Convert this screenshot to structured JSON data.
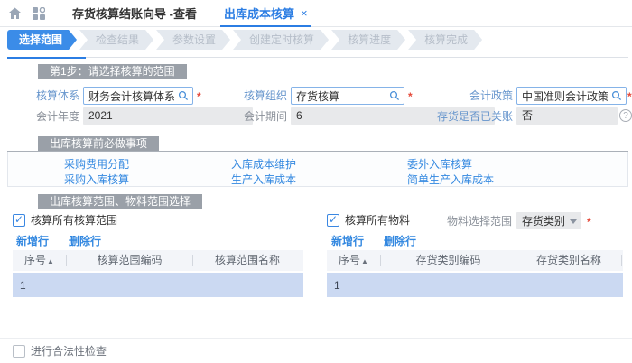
{
  "ui": {
    "required_mark": "*"
  },
  "icons": {
    "close_tab": "×",
    "sort_asc": "▲",
    "help": "?"
  },
  "topbar": {
    "tabs": [
      {
        "label": "存货核算结账向导 -查看",
        "active": false
      },
      {
        "label": "出库成本核算",
        "active": true
      }
    ]
  },
  "wizard": {
    "steps": [
      "选择范围",
      "检查结果",
      "参数设置",
      "创建定时核算",
      "核算进度",
      "核算完成"
    ],
    "active_step": "选择范围"
  },
  "step1": {
    "title": "第1步：请选择核算的范围",
    "fields": {
      "accounting_system": {
        "label": "核算体系",
        "value": "财务会计核算体系",
        "required": true
      },
      "accounting_org": {
        "label": "核算组织",
        "value": "存货核算",
        "required": true
      },
      "accounting_policy": {
        "label": "会计政策",
        "value": "中国准则会计政策",
        "required": true
      },
      "fiscal_year": {
        "label": "会计年度",
        "value": "2021"
      },
      "fiscal_period": {
        "label": "会计期间",
        "value": "6"
      },
      "inventory_closed": {
        "label": "存货是否已关账",
        "value": "否"
      }
    }
  },
  "todo": {
    "title": "出库核算前必做事项",
    "links": [
      "采购费用分配",
      "入库成本维护",
      "委外入库核算",
      "采购入库核算",
      "生产入库成本",
      "简单生产入库成本"
    ]
  },
  "range": {
    "title": "出库核算范围、物料范围选择",
    "left": {
      "checkbox_label": "核算所有核算范围",
      "checked": true,
      "add_row": "新增行",
      "delete_row": "删除行",
      "columns": [
        "序号",
        "核算范围编码",
        "核算范围名称"
      ],
      "rows": [
        {
          "seq": "1",
          "code": "",
          "name": ""
        }
      ]
    },
    "right": {
      "checkbox_label": "核算所有物料",
      "checked": true,
      "material_label": "物料选择范围",
      "material_value": "存货类别",
      "material_required": true,
      "add_row": "新增行",
      "delete_row": "删除行",
      "columns": [
        "序号",
        "存货类别编码",
        "存货类别名称"
      ],
      "rows": [
        {
          "seq": "1",
          "code": "",
          "name": ""
        }
      ]
    }
  },
  "footer": {
    "checkbox_label": "进行合法性检查",
    "checked": false
  }
}
